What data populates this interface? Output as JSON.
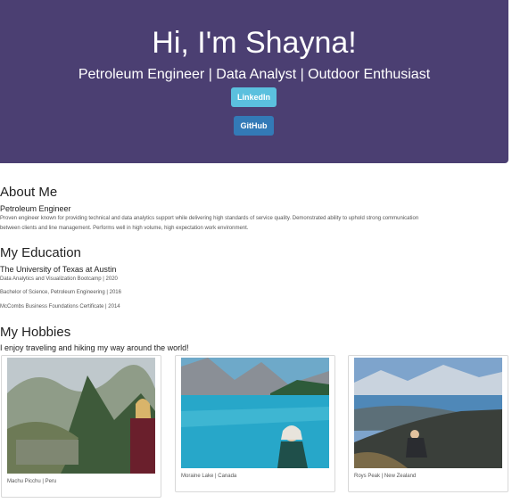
{
  "header": {
    "greeting": "Hi, I'm Shayna!",
    "tagline": "Petroleum Engineer | Data Analyst | Outdoor Enthusiast",
    "linkedin_label": "LinkedIn",
    "github_label": "GitHub"
  },
  "about": {
    "title": "About Me",
    "role": "Petroleum Engineer",
    "bio_line1": "Proven engineer known for providing technical and data analytics support while delivering high standards of service quality. Demonstrated ability to uphold strong communication",
    "bio_line2": "between clients and line management. Performs well in high volume, high expectation work environment."
  },
  "education": {
    "title": "My Education",
    "school": "The University of Texas at Austin",
    "items": [
      "Data Analytics and Visualization Bootcamp | 2020",
      "Bachelor of Science, Petroleum Engineering | 2016",
      "McCombs Business Foundations Certificate | 2014"
    ]
  },
  "hobbies": {
    "title": "My Hobbies",
    "intro": "I enjoy traveling and hiking my way around the world!",
    "photos": [
      {
        "caption": "Machu Picchu | Peru"
      },
      {
        "caption": "Moraine Lake | Canada"
      },
      {
        "caption": "Roys Peak | New Zealand"
      }
    ]
  },
  "colors": {
    "hero_bg": "#4b3f72",
    "linkedin_btn": "#5bc0de",
    "github_btn": "#337ab7"
  }
}
